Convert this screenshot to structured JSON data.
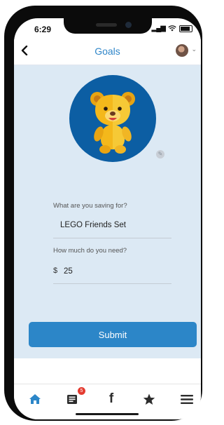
{
  "status_bar": {
    "time": "6:29"
  },
  "nav": {
    "back_icon": "chevron-left-icon",
    "title": "Goals",
    "profile": "avatar"
  },
  "goal_image": {
    "icon": "teddy-bear-icon",
    "edit_icon": "pencil-icon",
    "bg_color": "#0c5ea3"
  },
  "form": {
    "saving_for_label": "What are you saving for?",
    "saving_for_value": "LEGO Friends Set",
    "amount_label": "How much do you need?",
    "currency": "$",
    "amount_value": "25"
  },
  "submit_label": "Submit",
  "tab_bar": {
    "tabs": [
      {
        "name": "home",
        "icon": "home-icon",
        "active": true,
        "color": "#2c86c8"
      },
      {
        "name": "news",
        "icon": "newspaper-icon",
        "badge": "5"
      },
      {
        "name": "facebook",
        "icon": "facebook-icon",
        "glyph": "f"
      },
      {
        "name": "favorites",
        "icon": "star-icon"
      },
      {
        "name": "menu",
        "icon": "menu-icon"
      }
    ]
  },
  "colors": {
    "accent": "#2c86c8",
    "background": "#dce9f4",
    "badge": "#e43b30"
  }
}
